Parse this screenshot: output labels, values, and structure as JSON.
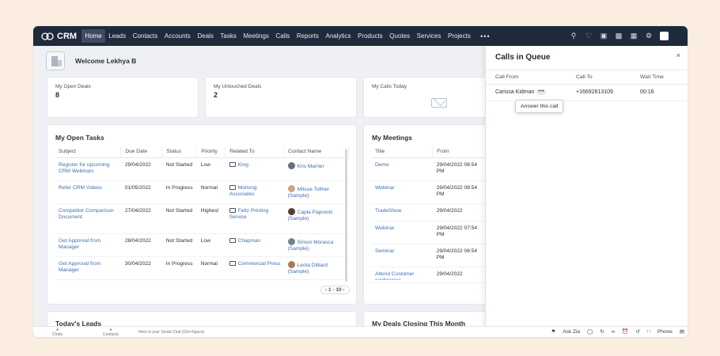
{
  "app": {
    "name": "CRM",
    "nav": [
      "Home",
      "Leads",
      "Contacts",
      "Accounts",
      "Deals",
      "Tasks",
      "Meetings",
      "Calls",
      "Reports",
      "Analytics",
      "Products",
      "Quotes",
      "Services",
      "Projects"
    ],
    "more": "•••",
    "top_icons": [
      "search-icon",
      "bell-icon",
      "add-icon",
      "screen-icon",
      "store-icon",
      "settings-icon",
      "profile-icon"
    ]
  },
  "welcome": {
    "text": "Welcome Lekhya B"
  },
  "stats": [
    {
      "label": "My Open Deals",
      "value": "8"
    },
    {
      "label": "My Untouched Deals",
      "value": "2"
    },
    {
      "label": "My Calls Today",
      "value": ""
    }
  ],
  "open_tasks": {
    "title": "My Open Tasks",
    "columns": [
      "Subject",
      "Due Date",
      "Status",
      "Priority",
      "Related To",
      "Contact Name"
    ],
    "rows": [
      {
        "subject": "Register for upcoming CRM Webinars",
        "due": "29/04/2022",
        "status": "Not Started",
        "priority": "Low",
        "related": "King",
        "contact": "Kris Marrier"
      },
      {
        "subject": "Refer CRM Videos",
        "due": "01/05/2022",
        "status": "In Progress",
        "priority": "Normal",
        "related": "Morlong Associates",
        "contact": "Mitsue Tollner (Sample)"
      },
      {
        "subject": "Competitor Comparison Document",
        "due": "27/04/2022",
        "status": "Not Started",
        "priority": "Highest",
        "related": "Feltz Printing Service",
        "contact": "Capla Paprocki (Sample)"
      },
      {
        "subject": "Get Apporval from Manager",
        "due": "28/04/2022",
        "status": "Not Started",
        "priority": "Low",
        "related": "Chapman",
        "contact": "Simon Morasca (Sample)"
      },
      {
        "subject": "Get Approval from Manager",
        "due": "30/04/2022",
        "status": "In Progress",
        "priority": "Normal",
        "related": "Commercial Press",
        "contact": "Leota Dilliard (Sample)"
      }
    ],
    "pager": "1 - 10"
  },
  "meetings": {
    "title": "My Meetings",
    "columns": [
      "Title",
      "From"
    ],
    "rows": [
      {
        "title": "Demo",
        "from": "29/04/2022 06:54 PM"
      },
      {
        "title": "Webinar",
        "from": "29/04/2022 08:54 PM"
      },
      {
        "title": "TradeShow",
        "from": "29/04/2022"
      },
      {
        "title": "Webinar",
        "from": "29/04/2022 07:54 PM"
      },
      {
        "title": "Seminar",
        "from": "29/04/2022 06:54 PM"
      },
      {
        "title": "Attend Customer conference",
        "from": "29/04/2022"
      }
    ]
  },
  "bottom_cards": {
    "leads": "Today's Leads",
    "deals": "My Deals Closing This Month"
  },
  "queue": {
    "title": "Calls in Queue",
    "close": "×",
    "columns": [
      "Call From",
      "Call To",
      "Wait Time"
    ],
    "row": {
      "from": "Carissa Kidman",
      "to": "+16692813109",
      "wait": "00:16"
    },
    "tooltip": "Answer this call"
  },
  "bottombar": {
    "chats": "Chats",
    "contacts": "Contacts",
    "smart_chat": "Here is your Smart Chat (Ctrl+Space)",
    "askzia": "Ask Zia",
    "phone": "Phone"
  }
}
